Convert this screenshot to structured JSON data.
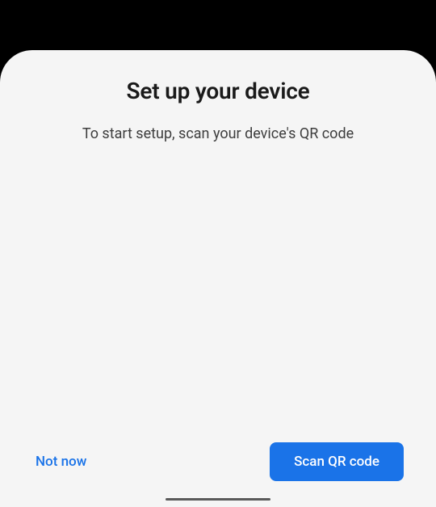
{
  "dialog": {
    "title": "Set up your device",
    "subtitle": "To start setup, scan your device's QR code"
  },
  "actions": {
    "dismiss_label": "Not now",
    "primary_label": "Scan QR code"
  }
}
